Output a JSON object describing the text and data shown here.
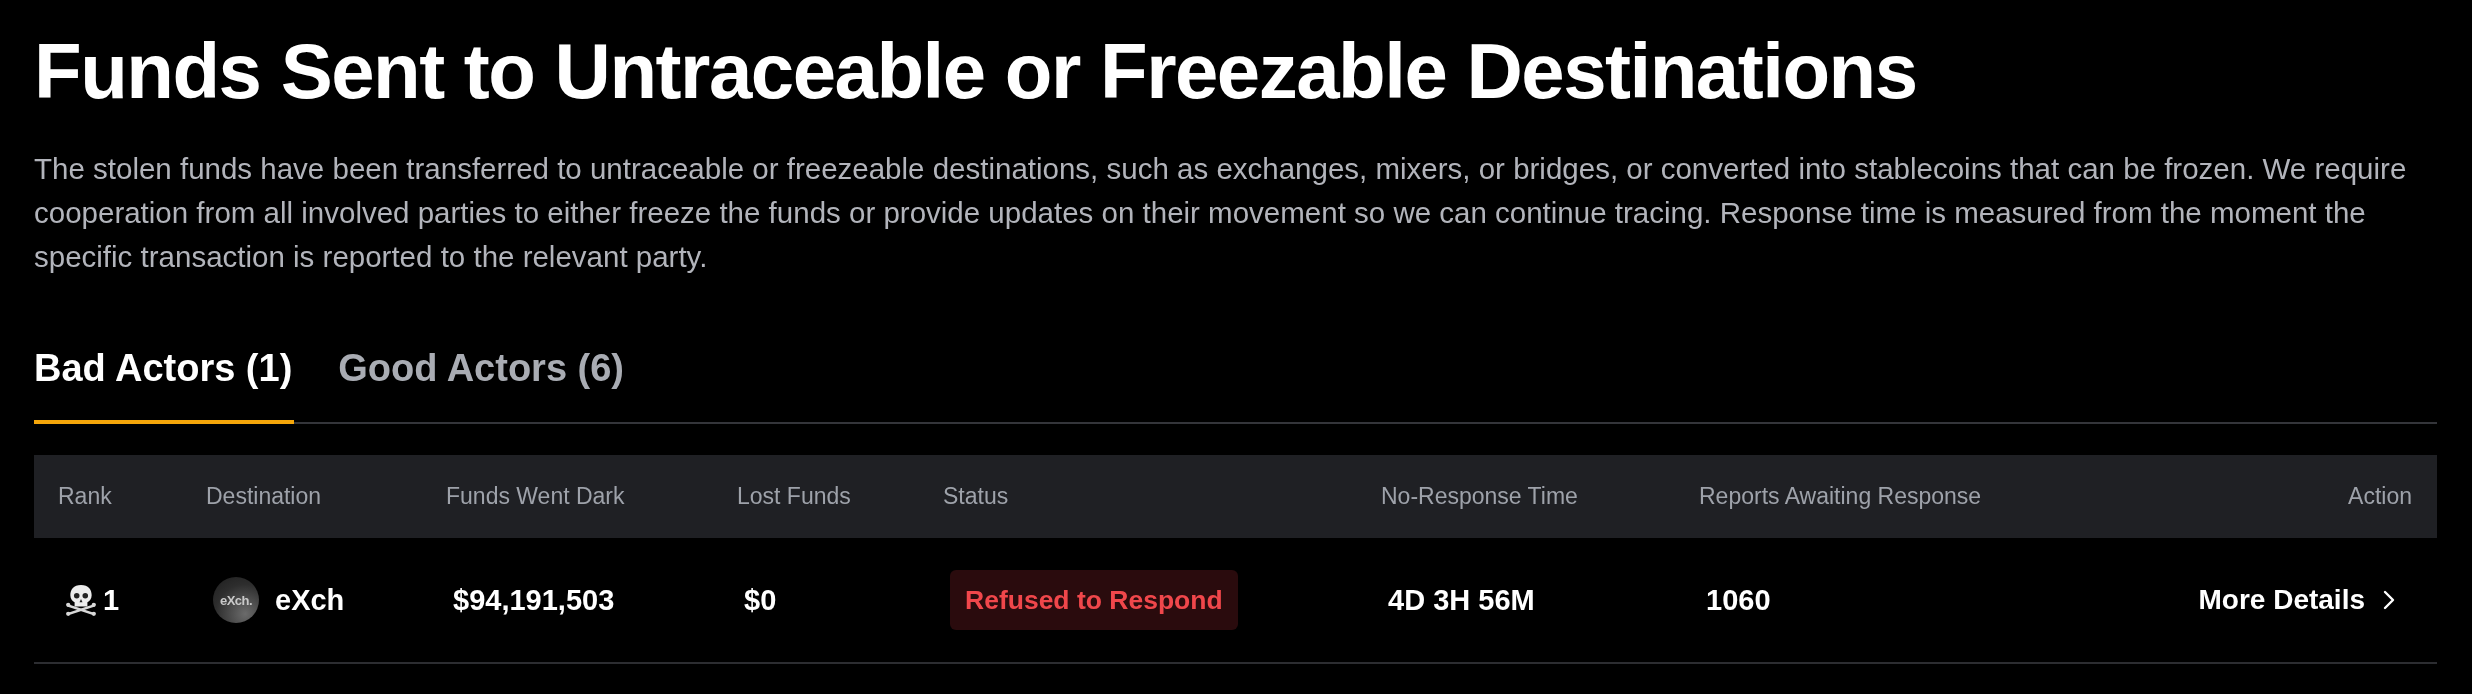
{
  "title": "Funds Sent to Untraceable or Freezable Destinations",
  "description": "The stolen funds have been transferred to untraceable or freezeable destinations, such as exchanges, mixers, or bridges, or converted into stablecoins that can be frozen. We require cooperation from all involved parties to either freeze the funds or provide updates on their movement so we can continue tracing. Response time is measured from the moment the specific transaction is reported to the relevant party.",
  "tabs": [
    {
      "label": "Bad Actors (1)",
      "selected": true
    },
    {
      "label": "Good Actors (6)",
      "selected": false
    }
  ],
  "table": {
    "columns": [
      "Rank",
      "Destination",
      "Funds Went Dark",
      "Lost Funds",
      "Status",
      "No-Response Time",
      "Reports Awaiting Response",
      "Action"
    ],
    "rows": [
      {
        "rank": "1",
        "destination": {
          "name": "eXch",
          "logo_text": "eXch."
        },
        "funds_went_dark": "$94,191,503",
        "lost_funds": "$0",
        "status": {
          "label": "Refused to Respond",
          "kind": "refused"
        },
        "no_response_time": "4D 3H 56M",
        "reports_awaiting_response": "1060",
        "action": "More Details"
      }
    ]
  }
}
